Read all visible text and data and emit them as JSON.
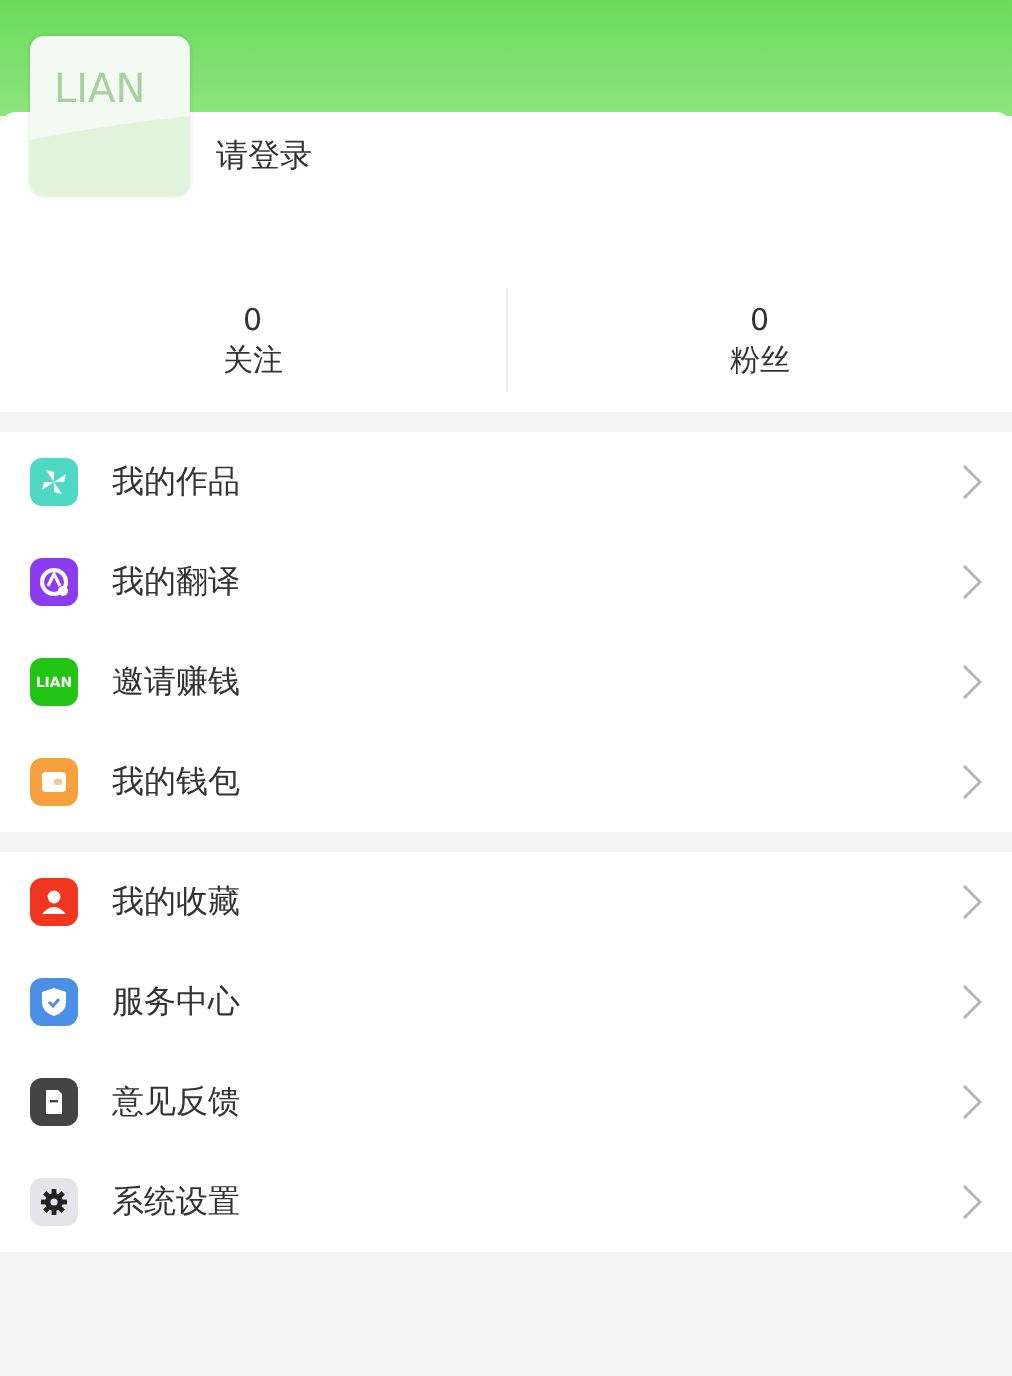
{
  "profile": {
    "avatar_logo": "LIAN",
    "login_prompt": "请登录"
  },
  "stats": [
    {
      "value": "0",
      "label": "关注"
    },
    {
      "value": "0",
      "label": "粉丝"
    }
  ],
  "menu_groups": [
    {
      "items": [
        {
          "label": "我的作品",
          "color": "#4fd8c4"
        },
        {
          "label": "我的翻译",
          "color": "#8b3cf0"
        },
        {
          "label": "邀请赚钱",
          "icon_text": "LIAN",
          "color": "#22c414"
        },
        {
          "label": "我的钱包",
          "color": "#f7a13e"
        }
      ]
    },
    {
      "items": [
        {
          "label": "我的收藏",
          "color": "#f0361e"
        },
        {
          "label": "服务中心",
          "color": "#4c8fe6"
        },
        {
          "label": "意见反馈",
          "color": "#444444"
        },
        {
          "label": "系统设置",
          "color": "#e4e4ea"
        }
      ]
    }
  ]
}
